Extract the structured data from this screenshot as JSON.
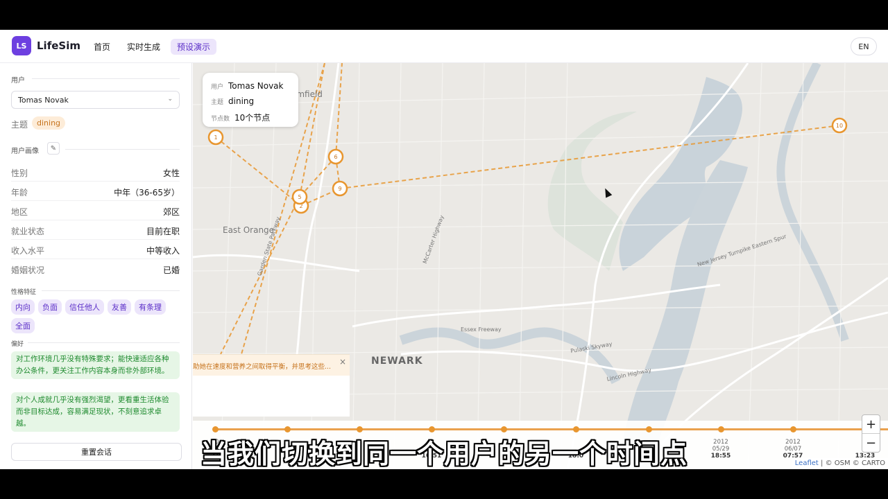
{
  "app": {
    "logo_text": "LS",
    "brand": "LifeSim",
    "nav": [
      "首页",
      "实时生成",
      "预设演示"
    ],
    "lang": "EN"
  },
  "sidebar": {
    "user_section": "用户",
    "user_select": "Tomas Novak",
    "theme_label": "主题",
    "theme_value": "dining",
    "profile_section": "用户画像",
    "attributes": [
      {
        "k": "性别",
        "v": "女性"
      },
      {
        "k": "年龄",
        "v": "中年（36-65岁）"
      },
      {
        "k": "地区",
        "v": "郊区"
      },
      {
        "k": "就业状态",
        "v": "目前在职"
      },
      {
        "k": "收入水平",
        "v": "中等收入"
      },
      {
        "k": "婚姻状况",
        "v": "已婚"
      }
    ],
    "traits_section": "性格特征",
    "traits": [
      "内向",
      "负面",
      "信任他人",
      "友善",
      "有条理",
      "全面"
    ],
    "prefs_section": "偏好",
    "prefs": [
      "对工作环境几乎没有特殊要求；能快速适应各种办公条件，更关注工作内容本身而非外部环境。",
      "对个人成就几乎没有强烈渴望，更看重生活体验而非目标达成，容易满足现状，不刻意追求卓越。"
    ],
    "reset": "重置会话"
  },
  "map": {
    "info": {
      "user_k": "用户",
      "user_v": "Tomas Novak",
      "theme_k": "主题",
      "theme_v": "dining",
      "nodes_k": "节点数",
      "nodes_v": "10个节点"
    },
    "message": "助她在速度和营养之间取得平衡，并思考这些...",
    "labels": {
      "bloomfield": "omfield",
      "east_orange": "East Orange",
      "newark": "NEWARK",
      "essex": "Essex Freeway",
      "pulaski": "Pulaski Skyway",
      "lincoln": "Lincoln Highway",
      "nj_turnpike": "New Jersey Turnpike Eastern Spur",
      "garden_state": "Garden State Parkway",
      "mccarter": "McCarter Highway"
    },
    "markers": [
      "1",
      "2",
      "5",
      "6",
      "9",
      "10"
    ],
    "zoom_in": "+",
    "zoom_out": "−",
    "attribution_leaflet": "Leaflet",
    "attribution_rest": "| © OSM © CARTO"
  },
  "timeline": [
    {
      "year": "20",
      "date": "04",
      "time": "21"
    },
    {
      "year": "",
      "date": "",
      "time": ""
    },
    {
      "year": "",
      "date": "",
      "time": ""
    },
    {
      "year": "",
      "date": "",
      "time": "16:51"
    },
    {
      "year": "",
      "date": "",
      "time": ""
    },
    {
      "year": "",
      "date": "",
      "time": "18:0"
    },
    {
      "year": "",
      "date": "",
      "time": ""
    },
    {
      "year": "2012",
      "date": "05/29",
      "time": "18:55"
    },
    {
      "year": "2012",
      "date": "06/07",
      "time": "07:57"
    },
    {
      "year": "2",
      "date": "0",
      "time": "13:23"
    }
  ],
  "subtitle": "当我们切换到同一个用户的另一个时间点",
  "colors": {
    "accent": "#6d3fe0",
    "route": "#e8962f",
    "pref_bg": "#e6f6e6"
  }
}
